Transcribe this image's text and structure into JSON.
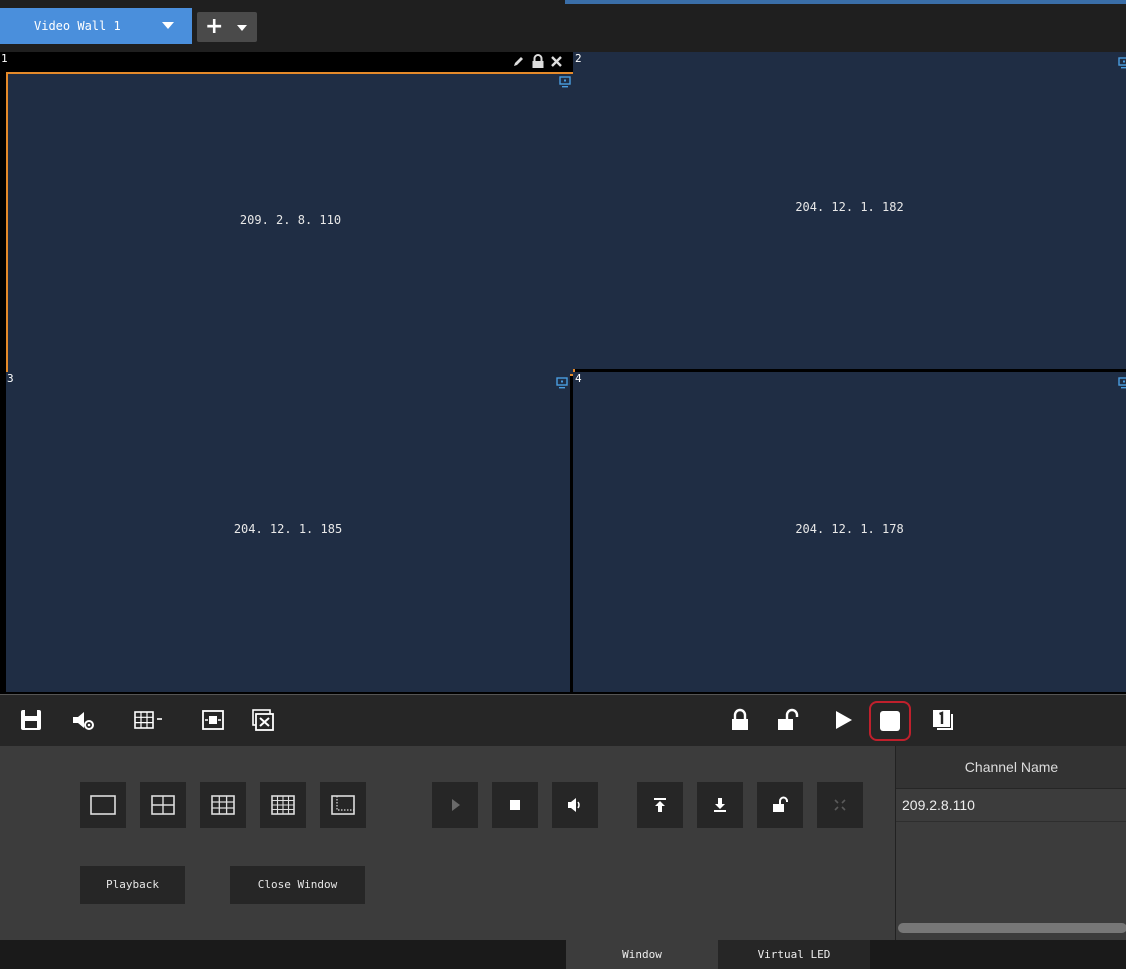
{
  "top_tabs": {
    "active_tab": "Video Wall 1"
  },
  "cells": [
    {
      "number": "1",
      "ip": "209. 2. 8. 110"
    },
    {
      "number": "2",
      "ip": "204. 12. 1. 182"
    },
    {
      "number": "3",
      "ip": "204. 12. 1. 185"
    },
    {
      "number": "4",
      "ip": "204. 12. 1. 178"
    }
  ],
  "panel": {
    "playback_label": "Playback",
    "close_window_label": "Close Window"
  },
  "table": {
    "column_header": "Channel Name",
    "rows": [
      "209.2.8.110"
    ]
  },
  "bottom_tabs": [
    "Window",
    "Virtual LED"
  ],
  "colors": {
    "accent": "#4a8fdc",
    "selected_border": "#e58a2a",
    "highlight": "#c0202c",
    "cell_bg": "#1f2d44"
  }
}
